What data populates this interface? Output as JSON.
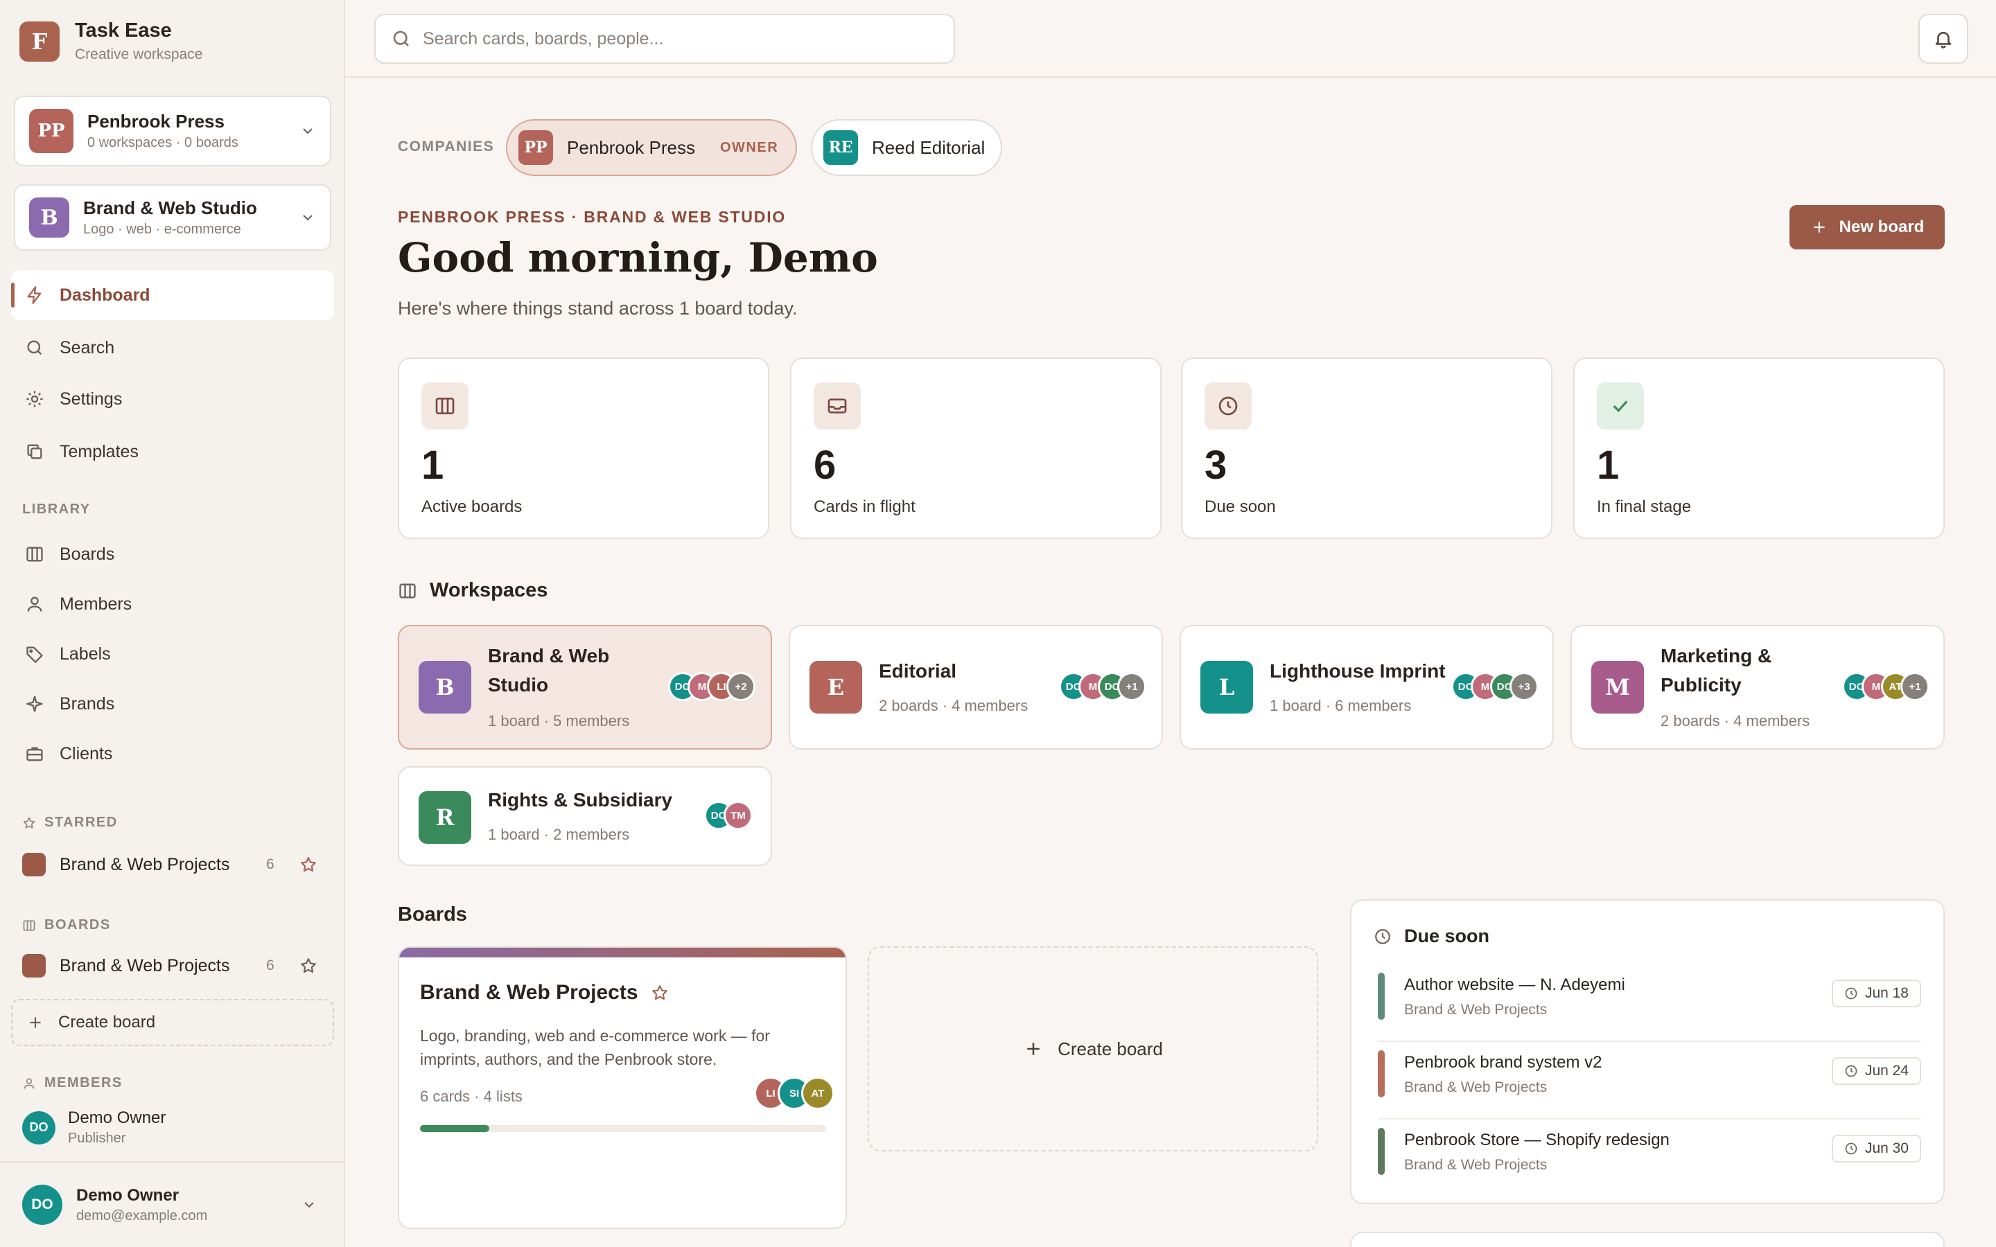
{
  "app": {
    "name": "Task Ease",
    "subtitle": "Creative workspace",
    "logo_letter": "F",
    "accent": "#a8624e"
  },
  "switchers": {
    "company": {
      "badge": "PP",
      "title": "Penbrook Press",
      "sub": "0 workspaces · 0 boards"
    },
    "workspace": {
      "badge": "B",
      "title": "Brand & Web Studio",
      "sub": "Logo · web · e-commerce"
    }
  },
  "nav": [
    {
      "label": "Dashboard",
      "icon": "bolt-icon"
    },
    {
      "label": "Search",
      "icon": "search-icon"
    },
    {
      "label": "Settings",
      "icon": "gear-icon"
    },
    {
      "label": "Templates",
      "icon": "copy-icon"
    }
  ],
  "library": {
    "label": "LIBRARY",
    "items": [
      {
        "label": "Boards",
        "icon": "columns-icon"
      },
      {
        "label": "Members",
        "icon": "user-icon"
      },
      {
        "label": "Labels",
        "icon": "tag-icon"
      },
      {
        "label": "Brands",
        "icon": "sparkle-icon"
      },
      {
        "label": "Clients",
        "icon": "briefcase-icon"
      }
    ]
  },
  "starred": {
    "label": "STARRED",
    "items": [
      {
        "name": "Brand & Web Projects",
        "count": "6"
      }
    ]
  },
  "boards_section": {
    "label": "BOARDS",
    "items": [
      {
        "name": "Brand & Web Projects",
        "count": "6"
      }
    ],
    "create_label": "Create board"
  },
  "members_section": {
    "label": "MEMBERS",
    "items": [
      {
        "initials": "DO",
        "name": "Demo Owner",
        "role": "Publisher"
      }
    ]
  },
  "current_user": {
    "initials": "DO",
    "name": "Demo Owner",
    "email": "demo@example.com"
  },
  "search": {
    "placeholder": "Search cards, boards, people..."
  },
  "companies": {
    "label": "COMPANIES",
    "items": [
      {
        "badge": "PP",
        "name": "Penbrook Press",
        "tag": "OWNER",
        "color": "#b4645a"
      },
      {
        "badge": "RE",
        "name": "Reed Editorial",
        "tag": "",
        "color": "#13918a"
      }
    ]
  },
  "header": {
    "breadcrumb": "PENBROOK PRESS · BRAND & WEB STUDIO",
    "greeting": "Good morning, Demo",
    "subtitle": "Here's where things stand across 1 board today.",
    "new_board_label": "New board"
  },
  "stats": [
    {
      "value": "1",
      "label": "Active boards",
      "icon": "columns-icon"
    },
    {
      "value": "6",
      "label": "Cards in flight",
      "icon": "inbox-icon"
    },
    {
      "value": "3",
      "label": "Due soon",
      "icon": "clock-icon"
    },
    {
      "value": "1",
      "label": "In final stage",
      "icon": "check-icon"
    }
  ],
  "workspaces": {
    "title": "Workspaces",
    "items": [
      {
        "badge": "B",
        "color": "#8c6ab0",
        "name": "Brand & Web Studio",
        "meta": "1 board · 5 members",
        "avatars": [
          "DO",
          "M",
          "LI",
          "+2"
        ]
      },
      {
        "badge": "E",
        "color": "#b4645a",
        "name": "Editorial",
        "meta": "2 boards · 4 members",
        "avatars": [
          "DO",
          "M",
          "DO",
          "+1"
        ]
      },
      {
        "badge": "L",
        "color": "#13918a",
        "name": "Lighthouse Imprint",
        "meta": "1 board · 6 members",
        "avatars": [
          "DO",
          "M",
          "DO",
          "+3"
        ]
      },
      {
        "badge": "M",
        "color": "#a85c8e",
        "name": "Marketing & Publicity",
        "meta": "2 boards · 4 members",
        "avatars": [
          "DO",
          "M",
          "AT",
          "+1"
        ]
      },
      {
        "badge": "R",
        "color": "#3a8a5c",
        "name": "Rights & Subsidiary",
        "meta": "1 board · 2 members",
        "avatars": [
          "DO",
          "TM"
        ]
      }
    ]
  },
  "boards": {
    "title": "Boards",
    "card": {
      "name": "Brand & Web Projects",
      "description": "Logo, branding, web and e-commerce work — for imprints, authors, and the Penbrook store.",
      "meta": "6 cards · 4 lists",
      "avatars": [
        "LI",
        "SI",
        "AT"
      ],
      "progress": 0.17
    },
    "create_label": "Create board"
  },
  "due_soon": {
    "title": "Due soon",
    "items": [
      {
        "title": "Author website — N. Adeyemi",
        "board": "Brand & Web Projects",
        "date": "Jun 18",
        "color": "#5e8a7a"
      },
      {
        "title": "Penbrook brand system v2",
        "board": "Brand & Web Projects",
        "date": "Jun 24",
        "color": "#b86e58"
      },
      {
        "title": "Penbrook Store — Shopify redesign",
        "board": "Brand & Web Projects",
        "date": "Jun 30",
        "color": "#5e7a5e"
      }
    ]
  }
}
